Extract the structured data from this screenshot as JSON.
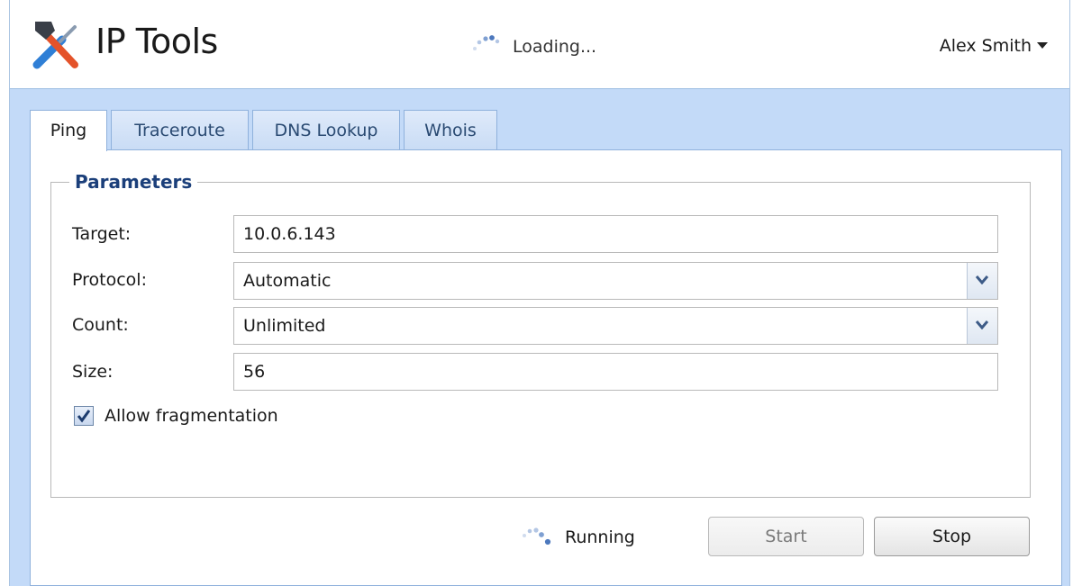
{
  "header": {
    "app_title": "IP Tools",
    "logo_icon": "tools-icon",
    "loading_text": "Loading...",
    "user_name": "Alex Smith"
  },
  "tabs": [
    {
      "label": "Ping",
      "active": true
    },
    {
      "label": "Traceroute",
      "active": false
    },
    {
      "label": "DNS Lookup",
      "active": false
    },
    {
      "label": "Whois",
      "active": false
    }
  ],
  "parameters": {
    "legend": "Parameters",
    "target": {
      "label": "Target:",
      "value": "10.0.6.143"
    },
    "protocol": {
      "label": "Protocol:",
      "value": "Automatic"
    },
    "count": {
      "label": "Count:",
      "value": "Unlimited"
    },
    "size": {
      "label": "Size:",
      "value": "56"
    },
    "allow_fragmentation": {
      "label": "Allow fragmentation",
      "checked": true
    }
  },
  "status": {
    "text": "Running"
  },
  "buttons": {
    "start": "Start",
    "stop": "Stop"
  },
  "colors": {
    "accent": "#1b3f7a",
    "panel_bg": "#c3daf8",
    "border": "#8fb1dc"
  }
}
